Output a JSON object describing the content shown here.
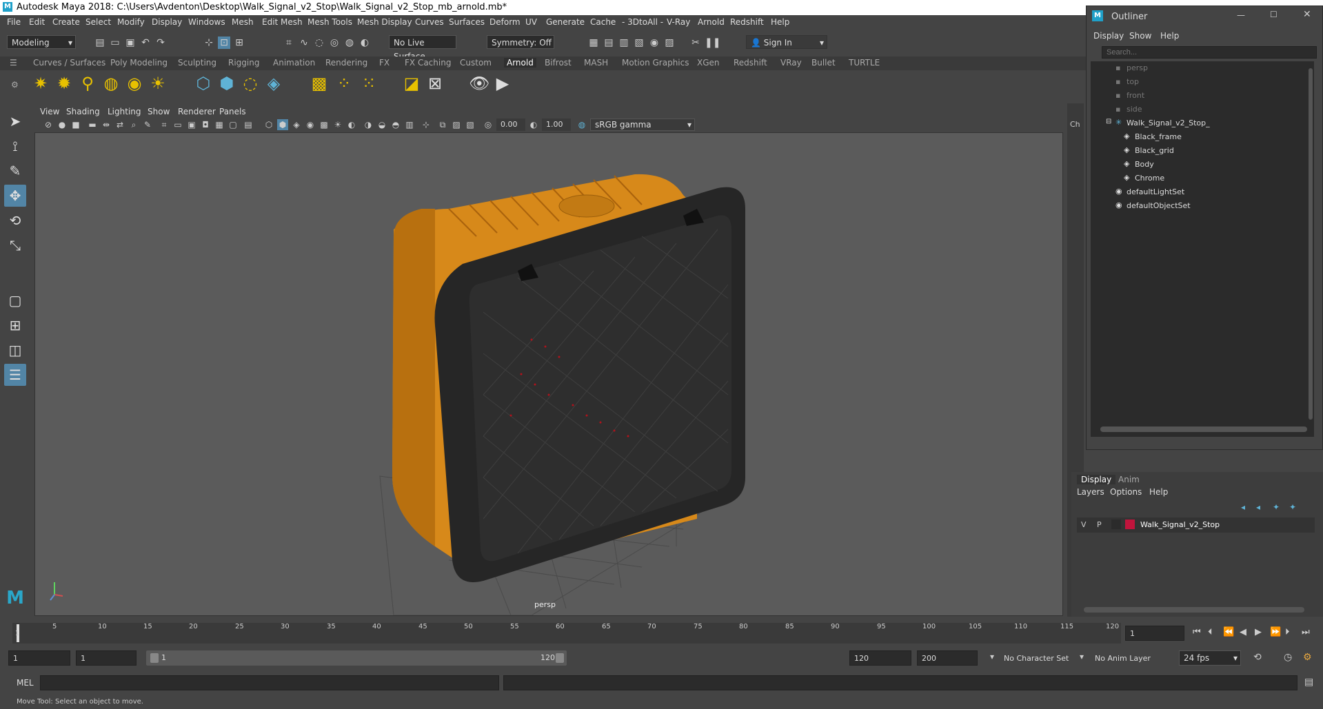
{
  "window": {
    "title": "Autodesk Maya 2018: C:\\Users\\Avdenton\\Desktop\\Walk_Signal_v2_Stop\\Walk_Signal_v2_Stop_mb_arnold.mb*",
    "logo": "M"
  },
  "menubar": [
    "File",
    "Edit",
    "Create",
    "Select",
    "Modify",
    "Display",
    "Windows",
    "Mesh",
    "Edit Mesh",
    "Mesh Tools",
    "Mesh Display",
    "Curves",
    "Surfaces",
    "Deform",
    "UV",
    "Generate",
    "Cache",
    "- 3DtoAll -",
    "V-Ray",
    "Arnold",
    "Redshift",
    "Help"
  ],
  "statusbar": {
    "menuset": "Modeling",
    "live_surface": "No Live Surface",
    "symmetry": "Symmetry: Off",
    "sign_in": "Sign In"
  },
  "shelf_tabs": [
    "Curves / Surfaces",
    "Poly Modeling",
    "Sculpting",
    "Rigging",
    "Animation",
    "Rendering",
    "FX",
    "FX Caching",
    "Custom",
    "Arnold",
    "Bifrost",
    "MASH",
    "Motion Graphics",
    "XGen",
    "Redshift",
    "VRay",
    "Bullet",
    "TURTLE"
  ],
  "shelf_active": "Arnold",
  "viewport": {
    "menus": [
      "View",
      "Shading",
      "Lighting",
      "Show",
      "Renderer",
      "Panels"
    ],
    "exposure": "0.00",
    "gamma": "1.00",
    "colorspace": "sRGB gamma",
    "camera_label": "persp",
    "side_tab": "Ch"
  },
  "outliner": {
    "title": "Outliner",
    "menus": [
      "Display",
      "Show",
      "Help"
    ],
    "search_placeholder": "Search...",
    "items": [
      {
        "label": "persp",
        "type": "camera",
        "dim": true,
        "indent": 0
      },
      {
        "label": "top",
        "type": "camera",
        "dim": true,
        "indent": 0
      },
      {
        "label": "front",
        "type": "camera",
        "dim": true,
        "indent": 0
      },
      {
        "label": "side",
        "type": "camera",
        "dim": true,
        "indent": 0
      },
      {
        "label": "Walk_Signal_v2_Stop_",
        "type": "group",
        "dim": false,
        "indent": 0
      },
      {
        "label": "Black_frame",
        "type": "mesh",
        "dim": false,
        "indent": 1
      },
      {
        "label": "Black_grid",
        "type": "mesh",
        "dim": false,
        "indent": 1
      },
      {
        "label": "Body",
        "type": "mesh",
        "dim": false,
        "indent": 1
      },
      {
        "label": "Chrome",
        "type": "mesh",
        "dim": false,
        "indent": 1
      },
      {
        "label": "defaultLightSet",
        "type": "set",
        "dim": false,
        "indent": 0
      },
      {
        "label": "defaultObjectSet",
        "type": "set",
        "dim": false,
        "indent": 0
      }
    ]
  },
  "layer_editor": {
    "tabs": [
      "Display",
      "Anim"
    ],
    "menus": [
      "Layers",
      "Options",
      "Help"
    ],
    "layer": {
      "v": "V",
      "p": "P",
      "name": "Walk_Signal_v2_Stop",
      "color": "#c0143c"
    }
  },
  "timeline": {
    "ticks": [
      "1",
      "5",
      "10",
      "15",
      "20",
      "25",
      "30",
      "35",
      "40",
      "45",
      "50",
      "55",
      "60",
      "65",
      "70",
      "75",
      "80",
      "85",
      "90",
      "95",
      "100",
      "105",
      "110",
      "115",
      "120"
    ],
    "current_frame": "1"
  },
  "range": {
    "start": "1",
    "playback_start": "1",
    "slider_start": "1",
    "slider_end": "120",
    "playback_end": "120",
    "end": "200",
    "character_set": "No Character Set",
    "anim_layer": "No Anim Layer",
    "fps": "24 fps"
  },
  "cmdline": {
    "label": "MEL"
  },
  "help_text": "Move Tool: Select an object to move.",
  "colors": {
    "accent": "#5285a6",
    "orange": "#d7891a",
    "layer_red": "#c0143c"
  }
}
